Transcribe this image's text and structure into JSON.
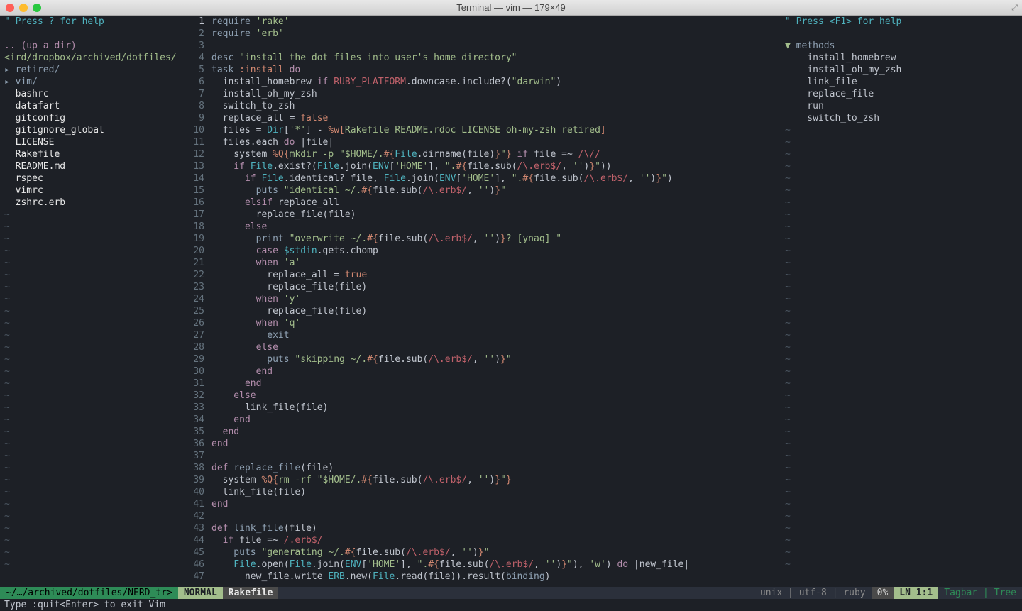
{
  "titlebar": {
    "title": "Terminal — vim — 179×49",
    "close": "#ff5f57",
    "min": "#febc2e",
    "zoom": "#28c840"
  },
  "nerd": {
    "help": "\" Press ? for help",
    "updir": ".. (up a dir)",
    "path": "<ird/dropbox/archived/dotfiles/",
    "items": [
      {
        "t": "▸ retired/",
        "cls": "nb"
      },
      {
        "t": "▸ vim/",
        "cls": "nb"
      },
      {
        "t": "  bashrc",
        "cls": "nw"
      },
      {
        "t": "  datafart",
        "cls": "nw"
      },
      {
        "t": "  gitconfig",
        "cls": "nw"
      },
      {
        "t": "  gitignore_global",
        "cls": "nw"
      },
      {
        "t": "  LICENSE",
        "cls": "nw"
      },
      {
        "t": "  Rakefile",
        "cls": "nw"
      },
      {
        "t": "  README.md",
        "cls": "nw"
      },
      {
        "t": "  rspec",
        "cls": "nw"
      },
      {
        "t": "  vimrc",
        "cls": "nw"
      },
      {
        "t": "  zshrc.erb",
        "cls": "nw"
      }
    ]
  },
  "code": [
    {
      "n": 1,
      "cur": true,
      "seg": [
        {
          "t": "require ",
          "c": "c-fn"
        },
        {
          "t": "'rake'",
          "c": "c-str"
        }
      ]
    },
    {
      "n": 2,
      "seg": [
        {
          "t": "require ",
          "c": "c-fn"
        },
        {
          "t": "'erb'",
          "c": "c-str"
        }
      ]
    },
    {
      "n": 3,
      "seg": [
        {
          "t": ""
        }
      ]
    },
    {
      "n": 4,
      "seg": [
        {
          "t": "desc ",
          "c": "c-fn"
        },
        {
          "t": "\"install the dot files into user's home directory\"",
          "c": "c-str"
        }
      ]
    },
    {
      "n": 5,
      "seg": [
        {
          "t": "task ",
          "c": "c-fn"
        },
        {
          "t": ":install",
          "c": "c-cn"
        },
        {
          "t": " do",
          "c": "c-kw"
        }
      ]
    },
    {
      "n": 6,
      "seg": [
        {
          "t": "  install_homebrew "
        },
        {
          "t": "if ",
          "c": "c-kw"
        },
        {
          "t": "RUBY_PLATFORM",
          "c": "c-red"
        },
        {
          "t": ".downcase.include?("
        },
        {
          "t": "\"darwin\"",
          "c": "c-str"
        },
        {
          "t": ")"
        }
      ]
    },
    {
      "n": 7,
      "seg": [
        {
          "t": "  install_oh_my_zsh"
        }
      ]
    },
    {
      "n": 8,
      "seg": [
        {
          "t": "  switch_to_zsh"
        }
      ]
    },
    {
      "n": 9,
      "seg": [
        {
          "t": "  replace_all = "
        },
        {
          "t": "false",
          "c": "c-cn"
        }
      ]
    },
    {
      "n": 10,
      "seg": [
        {
          "t": "  files = "
        },
        {
          "t": "Dir",
          "c": "c-sp"
        },
        {
          "t": "["
        },
        {
          "t": "'*'",
          "c": "c-str"
        },
        {
          "t": "] - "
        },
        {
          "t": "%w[",
          "c": "c-cn"
        },
        {
          "t": "Rakefile README.rdoc LICENSE oh-my-zsh retired",
          "c": "c-str"
        },
        {
          "t": "]",
          "c": "c-cn"
        }
      ]
    },
    {
      "n": 11,
      "seg": [
        {
          "t": "  files.each "
        },
        {
          "t": "do",
          "c": "c-kw"
        },
        {
          "t": " |file|"
        }
      ]
    },
    {
      "n": 12,
      "seg": [
        {
          "t": "    system "
        },
        {
          "t": "%Q{",
          "c": "c-cn"
        },
        {
          "t": "mkdir -p \"$HOME/.",
          "c": "c-str"
        },
        {
          "t": "#{",
          "c": "c-cn"
        },
        {
          "t": "File",
          "c": "c-sp"
        },
        {
          "t": ".dirname(file)"
        },
        {
          "t": "}",
          "c": "c-cn"
        },
        {
          "t": "\"",
          "c": "c-str"
        },
        {
          "t": "}",
          "c": "c-cn"
        },
        {
          "t": " if",
          "c": "c-kw"
        },
        {
          "t": " file =~ "
        },
        {
          "t": "/\\//",
          "c": "c-red"
        }
      ]
    },
    {
      "n": 13,
      "seg": [
        {
          "t": "    if ",
          "c": "c-kw"
        },
        {
          "t": "File",
          "c": "c-sp"
        },
        {
          "t": ".exist?("
        },
        {
          "t": "File",
          "c": "c-sp"
        },
        {
          "t": ".join("
        },
        {
          "t": "ENV",
          "c": "c-sp"
        },
        {
          "t": "["
        },
        {
          "t": "'HOME'",
          "c": "c-str"
        },
        {
          "t": "], "
        },
        {
          "t": "\".",
          "c": "c-str"
        },
        {
          "t": "#{",
          "c": "c-cn"
        },
        {
          "t": "file.sub("
        },
        {
          "t": "/\\.erb$/",
          "c": "c-red"
        },
        {
          "t": ", "
        },
        {
          "t": "''",
          "c": "c-str"
        },
        {
          "t": ")"
        },
        {
          "t": "}",
          "c": "c-cn"
        },
        {
          "t": "\"",
          "c": "c-str"
        },
        {
          "t": "))"
        }
      ]
    },
    {
      "n": 14,
      "seg": [
        {
          "t": "      if ",
          "c": "c-kw"
        },
        {
          "t": "File",
          "c": "c-sp"
        },
        {
          "t": ".identical? file, "
        },
        {
          "t": "File",
          "c": "c-sp"
        },
        {
          "t": ".join("
        },
        {
          "t": "ENV",
          "c": "c-sp"
        },
        {
          "t": "["
        },
        {
          "t": "'HOME'",
          "c": "c-str"
        },
        {
          "t": "], "
        },
        {
          "t": "\".",
          "c": "c-str"
        },
        {
          "t": "#{",
          "c": "c-cn"
        },
        {
          "t": "file.sub("
        },
        {
          "t": "/\\.erb$/",
          "c": "c-red"
        },
        {
          "t": ", "
        },
        {
          "t": "''",
          "c": "c-str"
        },
        {
          "t": ")"
        },
        {
          "t": "}",
          "c": "c-cn"
        },
        {
          "t": "\"",
          "c": "c-str"
        },
        {
          "t": ")"
        }
      ]
    },
    {
      "n": 15,
      "seg": [
        {
          "t": "        puts ",
          "c": "c-fn"
        },
        {
          "t": "\"identical ~/.",
          "c": "c-str"
        },
        {
          "t": "#{",
          "c": "c-cn"
        },
        {
          "t": "file.sub("
        },
        {
          "t": "/\\.erb$/",
          "c": "c-red"
        },
        {
          "t": ", "
        },
        {
          "t": "''",
          "c": "c-str"
        },
        {
          "t": ")"
        },
        {
          "t": "}",
          "c": "c-cn"
        },
        {
          "t": "\"",
          "c": "c-str"
        }
      ]
    },
    {
      "n": 16,
      "seg": [
        {
          "t": "      elsif ",
          "c": "c-kw"
        },
        {
          "t": "replace_all"
        }
      ]
    },
    {
      "n": 17,
      "seg": [
        {
          "t": "        replace_file(file)"
        }
      ]
    },
    {
      "n": 18,
      "seg": [
        {
          "t": "      else",
          "c": "c-kw"
        }
      ]
    },
    {
      "n": 19,
      "seg": [
        {
          "t": "        print ",
          "c": "c-fn"
        },
        {
          "t": "\"overwrite ~/.",
          "c": "c-str"
        },
        {
          "t": "#{",
          "c": "c-cn"
        },
        {
          "t": "file.sub("
        },
        {
          "t": "/\\.erb$/",
          "c": "c-red"
        },
        {
          "t": ", "
        },
        {
          "t": "''",
          "c": "c-str"
        },
        {
          "t": ")"
        },
        {
          "t": "}",
          "c": "c-cn"
        },
        {
          "t": "? [ynaq] \"",
          "c": "c-str"
        }
      ]
    },
    {
      "n": 20,
      "seg": [
        {
          "t": "        case ",
          "c": "c-kw"
        },
        {
          "t": "$stdin",
          "c": "c-sp"
        },
        {
          "t": ".gets.chomp"
        }
      ]
    },
    {
      "n": 21,
      "seg": [
        {
          "t": "        when ",
          "c": "c-kw"
        },
        {
          "t": "'a'",
          "c": "c-str"
        }
      ]
    },
    {
      "n": 22,
      "seg": [
        {
          "t": "          replace_all = "
        },
        {
          "t": "true",
          "c": "c-cn"
        }
      ]
    },
    {
      "n": 23,
      "seg": [
        {
          "t": "          replace_file(file)"
        }
      ]
    },
    {
      "n": 24,
      "seg": [
        {
          "t": "        when ",
          "c": "c-kw"
        },
        {
          "t": "'y'",
          "c": "c-str"
        }
      ]
    },
    {
      "n": 25,
      "seg": [
        {
          "t": "          replace_file(file)"
        }
      ]
    },
    {
      "n": 26,
      "seg": [
        {
          "t": "        when ",
          "c": "c-kw"
        },
        {
          "t": "'q'",
          "c": "c-str"
        }
      ]
    },
    {
      "n": 27,
      "seg": [
        {
          "t": "          exit",
          "c": "c-fn"
        }
      ]
    },
    {
      "n": 28,
      "seg": [
        {
          "t": "        else",
          "c": "c-kw"
        }
      ]
    },
    {
      "n": 29,
      "seg": [
        {
          "t": "          puts ",
          "c": "c-fn"
        },
        {
          "t": "\"skipping ~/.",
          "c": "c-str"
        },
        {
          "t": "#{",
          "c": "c-cn"
        },
        {
          "t": "file.sub("
        },
        {
          "t": "/\\.erb$/",
          "c": "c-red"
        },
        {
          "t": ", "
        },
        {
          "t": "''",
          "c": "c-str"
        },
        {
          "t": ")"
        },
        {
          "t": "}",
          "c": "c-cn"
        },
        {
          "t": "\"",
          "c": "c-str"
        }
      ]
    },
    {
      "n": 30,
      "seg": [
        {
          "t": "        end",
          "c": "c-kw"
        }
      ]
    },
    {
      "n": 31,
      "seg": [
        {
          "t": "      end",
          "c": "c-kw"
        }
      ]
    },
    {
      "n": 32,
      "seg": [
        {
          "t": "    else",
          "c": "c-kw"
        }
      ]
    },
    {
      "n": 33,
      "seg": [
        {
          "t": "      link_file(file)"
        }
      ]
    },
    {
      "n": 34,
      "seg": [
        {
          "t": "    end",
          "c": "c-kw"
        }
      ]
    },
    {
      "n": 35,
      "seg": [
        {
          "t": "  end",
          "c": "c-kw"
        }
      ]
    },
    {
      "n": 36,
      "seg": [
        {
          "t": "end",
          "c": "c-kw"
        }
      ]
    },
    {
      "n": 37,
      "seg": [
        {
          "t": ""
        }
      ]
    },
    {
      "n": 38,
      "seg": [
        {
          "t": "def ",
          "c": "c-kw"
        },
        {
          "t": "replace_file",
          "c": "c-fn"
        },
        {
          "t": "(file)"
        }
      ]
    },
    {
      "n": 39,
      "seg": [
        {
          "t": "  system "
        },
        {
          "t": "%Q{",
          "c": "c-cn"
        },
        {
          "t": "rm -rf \"$HOME/.",
          "c": "c-str"
        },
        {
          "t": "#{",
          "c": "c-cn"
        },
        {
          "t": "file.sub("
        },
        {
          "t": "/\\.erb$/",
          "c": "c-red"
        },
        {
          "t": ", "
        },
        {
          "t": "''",
          "c": "c-str"
        },
        {
          "t": ")"
        },
        {
          "t": "}",
          "c": "c-cn"
        },
        {
          "t": "\"",
          "c": "c-str"
        },
        {
          "t": "}",
          "c": "c-cn"
        }
      ]
    },
    {
      "n": 40,
      "seg": [
        {
          "t": "  link_file(file)"
        }
      ]
    },
    {
      "n": 41,
      "seg": [
        {
          "t": "end",
          "c": "c-kw"
        }
      ]
    },
    {
      "n": 42,
      "seg": [
        {
          "t": ""
        }
      ]
    },
    {
      "n": 43,
      "seg": [
        {
          "t": "def ",
          "c": "c-kw"
        },
        {
          "t": "link_file",
          "c": "c-fn"
        },
        {
          "t": "(file)"
        }
      ]
    },
    {
      "n": 44,
      "seg": [
        {
          "t": "  if ",
          "c": "c-kw"
        },
        {
          "t": "file =~ "
        },
        {
          "t": "/.erb$/",
          "c": "c-red"
        }
      ]
    },
    {
      "n": 45,
      "seg": [
        {
          "t": "    puts ",
          "c": "c-fn"
        },
        {
          "t": "\"generating ~/.",
          "c": "c-str"
        },
        {
          "t": "#{",
          "c": "c-cn"
        },
        {
          "t": "file.sub("
        },
        {
          "t": "/\\.erb$/",
          "c": "c-red"
        },
        {
          "t": ", "
        },
        {
          "t": "''",
          "c": "c-str"
        },
        {
          "t": ")"
        },
        {
          "t": "}",
          "c": "c-cn"
        },
        {
          "t": "\"",
          "c": "c-str"
        }
      ]
    },
    {
      "n": 46,
      "seg": [
        {
          "t": "    File",
          "c": "c-sp"
        },
        {
          "t": ".open("
        },
        {
          "t": "File",
          "c": "c-sp"
        },
        {
          "t": ".join("
        },
        {
          "t": "ENV",
          "c": "c-sp"
        },
        {
          "t": "["
        },
        {
          "t": "'HOME'",
          "c": "c-str"
        },
        {
          "t": "], "
        },
        {
          "t": "\".",
          "c": "c-str"
        },
        {
          "t": "#{",
          "c": "c-cn"
        },
        {
          "t": "file.sub("
        },
        {
          "t": "/\\.erb$/",
          "c": "c-red"
        },
        {
          "t": ", "
        },
        {
          "t": "''",
          "c": "c-str"
        },
        {
          "t": ")"
        },
        {
          "t": "}",
          "c": "c-cn"
        },
        {
          "t": "\"",
          "c": "c-str"
        },
        {
          "t": "), "
        },
        {
          "t": "'w'",
          "c": "c-str"
        },
        {
          "t": ") "
        },
        {
          "t": "do",
          "c": "c-kw"
        },
        {
          "t": " |new_file|"
        }
      ]
    },
    {
      "n": 47,
      "seg": [
        {
          "t": "      new_file.write "
        },
        {
          "t": "ERB",
          "c": "c-sp"
        },
        {
          "t": ".new("
        },
        {
          "t": "File",
          "c": "c-sp"
        },
        {
          "t": ".read(file)).result("
        },
        {
          "t": "binding",
          "c": "c-fn"
        },
        {
          "t": ")"
        }
      ]
    }
  ],
  "tagbar": {
    "help": "\" Press <F1> for help",
    "section": "methods",
    "items": [
      "install_homebrew",
      "install_oh_my_zsh",
      "link_file",
      "replace_file",
      "run",
      "switch_to_zsh"
    ]
  },
  "status": {
    "left_path": "~/…/archived/dotfiles/NERD_tr>",
    "mode": " NORMAL ",
    "file": "Rakefile",
    "info": "unix | utf-8 | ruby",
    "pct": "0%",
    "ln": " LN    1:1 ",
    "right": "Tagbar | Tree"
  },
  "cmdline": "Type  :quit<Enter>  to exit Vim"
}
